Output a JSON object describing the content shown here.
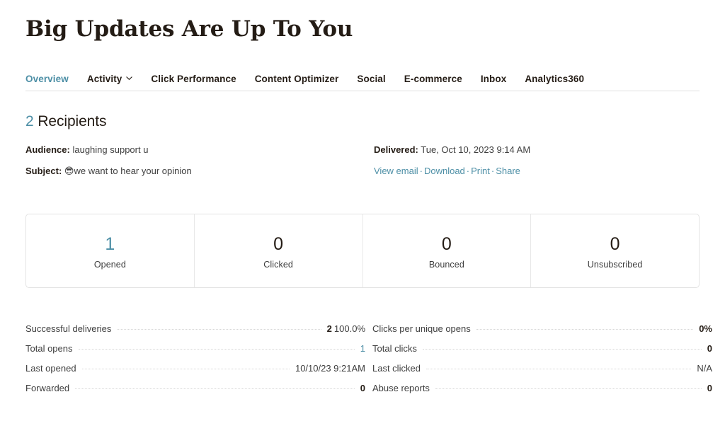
{
  "campaign": {
    "title": "Big Updates Are Up To You"
  },
  "tabs": [
    {
      "label": "Overview",
      "active": true,
      "has_chevron": false
    },
    {
      "label": "Activity",
      "active": false,
      "has_chevron": true
    },
    {
      "label": "Click Performance",
      "active": false,
      "has_chevron": false
    },
    {
      "label": "Content Optimizer",
      "active": false,
      "has_chevron": false
    },
    {
      "label": "Social",
      "active": false,
      "has_chevron": false
    },
    {
      "label": "E-commerce",
      "active": false,
      "has_chevron": false
    },
    {
      "label": "Inbox",
      "active": false,
      "has_chevron": false
    },
    {
      "label": "Analytics360",
      "active": false,
      "has_chevron": false
    }
  ],
  "recipients": {
    "count": "2",
    "label": "Recipients"
  },
  "meta": {
    "audience_label": "Audience:",
    "audience_value": "laughing support u",
    "subject_label": "Subject:",
    "subject_emoji": "😎",
    "subject_value": "we want to hear your opinion",
    "delivered_label": "Delivered:",
    "delivered_value": "Tue, Oct 10, 2023 9:14 AM",
    "links": [
      {
        "label": "View email"
      },
      {
        "label": "Download"
      },
      {
        "label": "Print"
      },
      {
        "label": "Share"
      }
    ],
    "link_separator": "·"
  },
  "stat_cards": [
    {
      "value": "1",
      "label": "Opened",
      "accent": true
    },
    {
      "value": "0",
      "label": "Clicked",
      "accent": false
    },
    {
      "value": "0",
      "label": "Bounced",
      "accent": false
    },
    {
      "value": "0",
      "label": "Unsubscribed",
      "accent": false
    }
  ],
  "detail_stats": {
    "left": [
      {
        "name": "Successful deliveries",
        "value": "2",
        "suffix": "100.0%",
        "style": "bold"
      },
      {
        "name": "Total opens",
        "value": "1",
        "suffix": "",
        "style": "accent"
      },
      {
        "name": "Last opened",
        "value": "10/10/23 9:21AM",
        "suffix": "",
        "style": "plain"
      },
      {
        "name": "Forwarded",
        "value": "0",
        "suffix": "",
        "style": "bold"
      }
    ],
    "right": [
      {
        "name": "Clicks per unique opens",
        "value": "0%",
        "suffix": "",
        "style": "bold"
      },
      {
        "name": "Total clicks",
        "value": "0",
        "suffix": "",
        "style": "bold"
      },
      {
        "name": "Last clicked",
        "value": "N/A",
        "suffix": "",
        "style": "plain"
      },
      {
        "name": "Abuse reports",
        "value": "0",
        "suffix": "",
        "style": "bold"
      }
    ]
  },
  "colors": {
    "accent": "#4d8fa6",
    "text": "#241c15",
    "muted": "#3d3d3d",
    "border": "#e3e3e3",
    "leader": "#d6d6d6"
  }
}
